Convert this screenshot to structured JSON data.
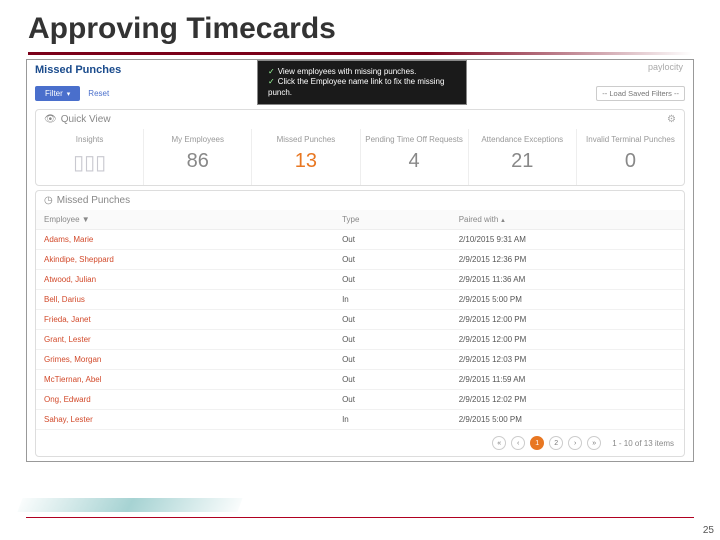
{
  "slide": {
    "title": "Approving Timecards",
    "page_num": "25"
  },
  "app": {
    "page_title": "Missed Punches",
    "tip": {
      "line1": "View employees with missing punches.",
      "line2": "Click the Employee name link to fix the missing punch."
    },
    "logo": "paylocity",
    "filterbar": {
      "filter_label": "Filter",
      "reset_label": "Reset",
      "load_saved_label": "-- Load Saved Filters --"
    },
    "quickview": {
      "title": "Quick View",
      "cells": [
        {
          "label": "Insights",
          "value": ""
        },
        {
          "label": "My Employees",
          "value": "86"
        },
        {
          "label": "Missed Punches",
          "value": "13"
        },
        {
          "label": "Pending Time Off Requests",
          "value": "4"
        },
        {
          "label": "Attendance Exceptions",
          "value": "21"
        },
        {
          "label": "Invalid Terminal Punches",
          "value": "0"
        }
      ]
    },
    "mp_panel_title": "Missed Punches",
    "table": {
      "headers": {
        "employee": "Employee",
        "type": "Type",
        "paired": "Paired with"
      },
      "rows": [
        {
          "emp": "Adams, Marie",
          "type": "Out",
          "paired": "2/10/2015 9:31 AM"
        },
        {
          "emp": "Akindipe, Sheppard",
          "type": "Out",
          "paired": "2/9/2015 12:36 PM"
        },
        {
          "emp": "Atwood, Julian",
          "type": "Out",
          "paired": "2/9/2015 11:36 AM"
        },
        {
          "emp": "Bell, Darius",
          "type": "In",
          "paired": "2/9/2015 5:00 PM"
        },
        {
          "emp": "Frieda, Janet",
          "type": "Out",
          "paired": "2/9/2015 12:00 PM"
        },
        {
          "emp": "Grant, Lester",
          "type": "Out",
          "paired": "2/9/2015 12:00 PM"
        },
        {
          "emp": "Grimes, Morgan",
          "type": "Out",
          "paired": "2/9/2015 12:03 PM"
        },
        {
          "emp": "McTiernan, Abel",
          "type": "Out",
          "paired": "2/9/2015 11:59 AM"
        },
        {
          "emp": "Ong, Edward",
          "type": "Out",
          "paired": "2/9/2015 12:02 PM"
        },
        {
          "emp": "Sahay, Lester",
          "type": "In",
          "paired": "2/9/2015 5:00 PM"
        }
      ]
    },
    "pager": {
      "pages": [
        "1",
        "2"
      ],
      "range": "1 - 10 of 13 items"
    }
  }
}
